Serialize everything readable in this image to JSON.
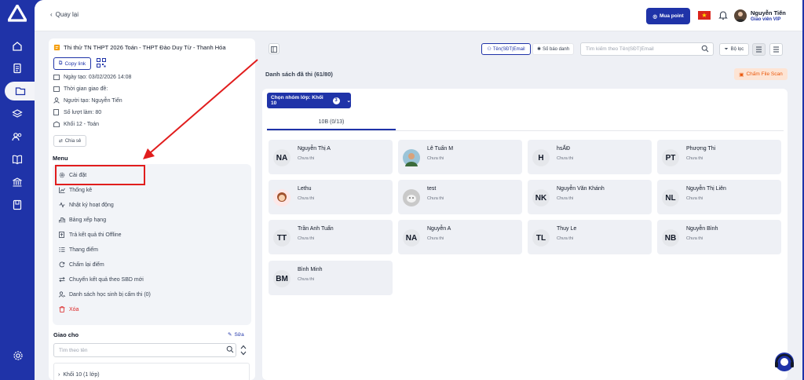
{
  "topbar": {
    "back_label": "Quay lại",
    "buy_label": "Mua point",
    "user_name": "Nguyễn Tiến",
    "user_role": "Giáo viên VIP"
  },
  "exam": {
    "title": "Thi thử TN THPT 2026 Toán - THPT Đào Duy Từ - Thanh Hóa",
    "copy_link": "Copy link",
    "created_date": "Ngày tạo: 03/02/2026 14:08",
    "assign_time": "Thời gian giao đề:",
    "creator": "Người tạo: Nguyễn Tiến",
    "attempts": "Số lượt làm: 80",
    "grade": "Khối 12 - Toán",
    "share": "Chia sẻ"
  },
  "menu": {
    "label": "Menu",
    "items": [
      "Cài đặt",
      "Thống kê",
      "Nhật ký hoạt động",
      "Bảng xếp hạng",
      "Trả kết quả thi Offline",
      "Thang điểm",
      "Chấm lại điểm",
      "Chuyển kết quả theo SBD mới",
      "Danh sách học sinh bị cấm thi (0)",
      "Xóa"
    ]
  },
  "assign": {
    "label": "Giao cho",
    "edit": "Sửa",
    "search_placeholder": "Tìm theo tên",
    "group": "Khối 10 (1 lớp)"
  },
  "toolbar": {
    "tab_name": "Tên(SĐT|Email",
    "tab_sbd": "Số báo danh",
    "search_placeholder": "Tìm kiếm theo Tên|SĐT|Email",
    "filter": "Bộ lọc"
  },
  "list": {
    "title": "Danh sách đã thi (61/80)",
    "file_scan": "Chấm File Scan",
    "group_select": "Chọn nhóm lớp: Khối 10",
    "group_count": "3",
    "class_tab": "10B (0/13)"
  },
  "students": [
    {
      "initials": "NA",
      "name": "Nguyễn Thị A",
      "status": "Chưa thi"
    },
    {
      "initials": "",
      "name": "Lê Tuấn M",
      "status": "Chưa thi"
    },
    {
      "initials": "H",
      "name": "hsẤĐ",
      "status": "Chưa thi"
    },
    {
      "initials": "PT",
      "name": "Phượng Thi",
      "status": "Chưa thi"
    },
    {
      "initials": "",
      "name": "Lethu",
      "status": "Chưa thi"
    },
    {
      "initials": "",
      "name": "test",
      "status": "Chưa thi"
    },
    {
      "initials": "NK",
      "name": "Nguyễn Văn Khánh",
      "status": "Chưa thi"
    },
    {
      "initials": "NL",
      "name": "Nguyễn Thị Liên",
      "status": "Chưa thi"
    },
    {
      "initials": "TT",
      "name": "Trần Anh Tuấn",
      "status": "Chưa thi"
    },
    {
      "initials": "NA",
      "name": "Nguyễn A",
      "status": "Chưa thi"
    },
    {
      "initials": "TL",
      "name": "Thuy Le",
      "status": "Chưa thi"
    },
    {
      "initials": "NB",
      "name": "Nguyễn Bình",
      "status": "Chưa thi"
    },
    {
      "initials": "BM",
      "name": "Bình Minh",
      "status": "Chưa thi"
    }
  ],
  "colors": {
    "brand": "#1f33a8",
    "annotation": "#e11d1d",
    "file_scan": "#ea580c"
  }
}
